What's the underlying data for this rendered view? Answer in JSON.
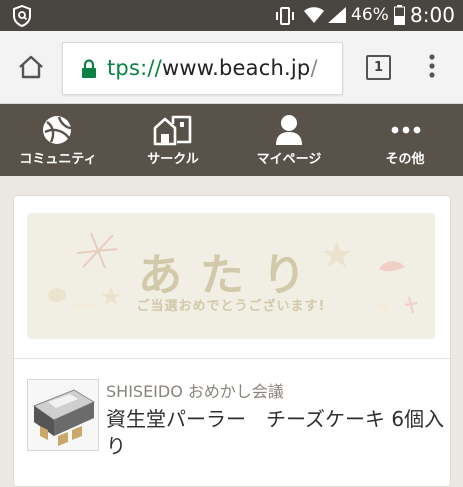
{
  "status_bar": {
    "battery_percent": "46%",
    "time": "8:00"
  },
  "browser": {
    "url_scheme": "tps://",
    "url_host": "www.beach.jp",
    "url_rest": "/",
    "tab_count": "1"
  },
  "nav": {
    "items": [
      {
        "label": "コミュニティ",
        "icon": "community-icon"
      },
      {
        "label": "サークル",
        "icon": "circle-icon"
      },
      {
        "label": "マイページ",
        "icon": "mypage-icon"
      },
      {
        "label": "その他",
        "icon": "more-icon"
      }
    ]
  },
  "banner": {
    "title": "あたり",
    "subtitle": "ご当選おめでとうございます!"
  },
  "product": {
    "brand": "SHISEIDO おめかし会議",
    "name": "資生堂パーラー　チーズケーキ 6個入り"
  },
  "colors": {
    "status_bar": "#494641",
    "nav_bar": "#58524a",
    "page_background": "#eae8e1",
    "secure_green": "#0b8043",
    "banner_text": "#d2c8aa"
  }
}
